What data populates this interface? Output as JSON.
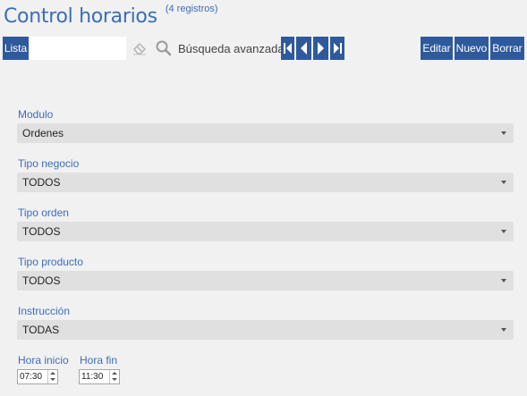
{
  "header": {
    "title": "Control horarios",
    "record_count": "(4 registros)"
  },
  "toolbar": {
    "list_label": "Lista",
    "search_value": "",
    "clear_icon": "eraser-icon",
    "search_icon": "magnifier-icon",
    "advanced_search_label": "Búsqueda avanzada",
    "nav": [
      "first-record-icon",
      "previous-record-icon",
      "next-record-icon",
      "last-record-icon"
    ],
    "edit_label": "Editar",
    "new_label": "Nuevo",
    "delete_label": "Borrar"
  },
  "form": {
    "fields": [
      {
        "label": "Modulo",
        "value": "Ordenes"
      },
      {
        "label": "Tipo negocio",
        "value": "TODOS"
      },
      {
        "label": "Tipo orden",
        "value": "TODOS"
      },
      {
        "label": "Tipo producto",
        "value": "TODOS"
      },
      {
        "label": "Instrucción",
        "value": "TODAS"
      }
    ],
    "start_time": {
      "label": "Hora inicio",
      "value": "07:30"
    },
    "end_time": {
      "label": "Hora fin",
      "value": "11:30"
    }
  },
  "colors": {
    "accent": "#2e5a9c",
    "title": "#3d6db8",
    "background": "#f1f1f1",
    "select_background": "#e0e0e0"
  }
}
